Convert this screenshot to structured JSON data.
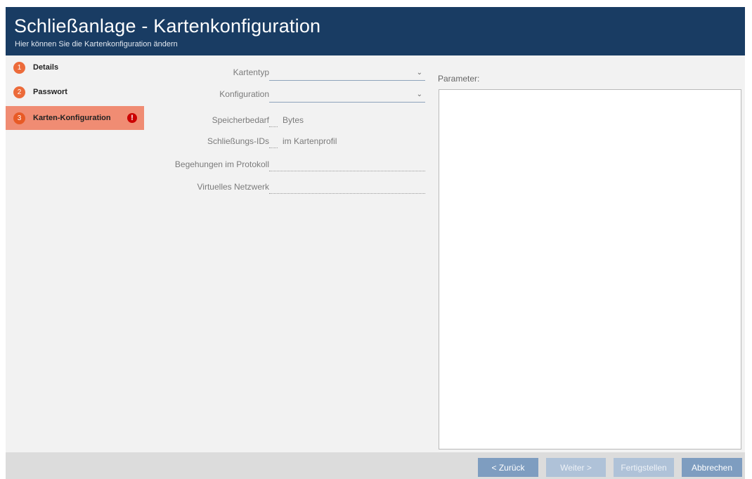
{
  "header": {
    "title": "Schließanlage - Kartenkonfiguration",
    "subtitle": "Hier können Sie die Kartenkonfiguration ändern"
  },
  "steps": [
    {
      "num": "1",
      "label": "Details"
    },
    {
      "num": "2",
      "label": "Passwort"
    },
    {
      "num": "3",
      "label": "Karten-Konfiguration",
      "active": true,
      "error_icon": "!"
    }
  ],
  "form": {
    "kartentyp": {
      "label": "Kartentyp",
      "value": ""
    },
    "konfiguration": {
      "label": "Konfiguration",
      "value": ""
    },
    "speicherbedarf": {
      "label": "Speicherbedarf",
      "unit": "Bytes"
    },
    "schliessungs_ids": {
      "label": "Schließungs-IDs",
      "suffix": "im Kartenprofil"
    },
    "begehungen": {
      "label": "Begehungen im Protokoll"
    },
    "netzwerk": {
      "label": "Virtuelles Netzwerk"
    }
  },
  "parameter": {
    "label": "Parameter:"
  },
  "buttons": {
    "back": "< Zurück",
    "next": "Weiter >",
    "finish": "Fertigstellen",
    "cancel": "Abbrechen"
  },
  "colors": {
    "header_bg": "#193c63",
    "active_step": "#f08c73",
    "step_badge": "#ec6b3a",
    "error": "#cc0000",
    "button": "#7e9dc0"
  }
}
